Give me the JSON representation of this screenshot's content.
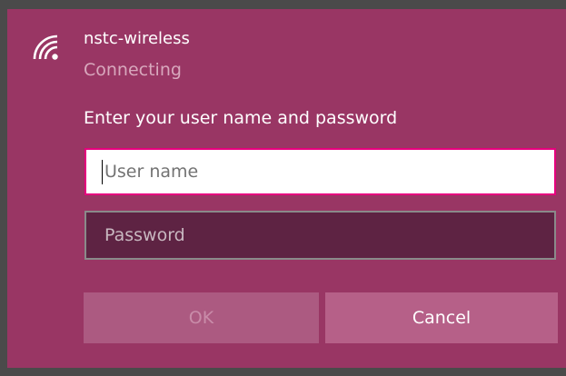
{
  "network": {
    "icon": "wifi-secured-icon",
    "name": "nstc-wireless",
    "status": "Connecting"
  },
  "prompt": "Enter your user name and password",
  "fields": {
    "username": {
      "placeholder": "User name",
      "value": ""
    },
    "password": {
      "placeholder": "Password",
      "value": ""
    }
  },
  "buttons": {
    "ok": {
      "label": "OK",
      "enabled": false
    },
    "cancel": {
      "label": "Cancel",
      "enabled": true
    }
  },
  "colors": {
    "accent": "#e6007e",
    "panel": "#993664",
    "button": "#b66088",
    "button_disabled": "#ac5a81"
  }
}
